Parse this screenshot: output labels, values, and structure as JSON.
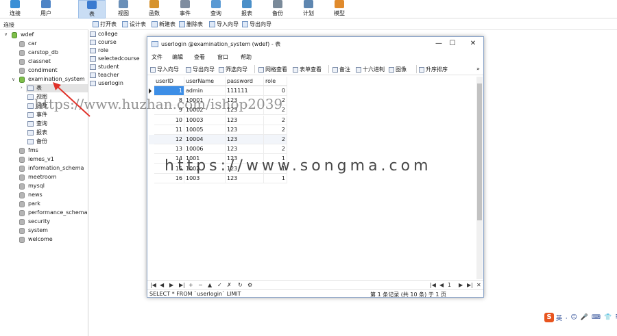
{
  "toolbar": {
    "buttons": [
      {
        "label": "连接",
        "icon": "connection-icon",
        "color": "#3a8fd6"
      },
      {
        "label": "用户",
        "icon": "user-icon",
        "color": "#4e84c6"
      },
      {
        "label": "表",
        "icon": "table-icon",
        "color": "#3b7bd0",
        "active": true
      },
      {
        "label": "视图",
        "icon": "view-icon",
        "color": "#6a8fb8"
      },
      {
        "label": "函数",
        "icon": "function-icon",
        "color": "#d6932e"
      },
      {
        "label": "事件",
        "icon": "event-icon",
        "color": "#7f8da0"
      },
      {
        "label": "查询",
        "icon": "query-icon",
        "color": "#5a9ad4"
      },
      {
        "label": "报表",
        "icon": "report-icon",
        "color": "#4a8fc8"
      },
      {
        "label": "备份",
        "icon": "backup-icon",
        "color": "#7a8a9a"
      },
      {
        "label": "计划",
        "icon": "schedule-icon",
        "color": "#5e86b0"
      },
      {
        "label": "模型",
        "icon": "model-icon",
        "color": "#e08a2c"
      }
    ]
  },
  "connection_label": "连接",
  "object_toolbar": [
    "打开表",
    "设计表",
    "新建表",
    "删除表",
    "导入向导",
    "导出向导"
  ],
  "tree": {
    "root": "wdef",
    "databases_before": [
      "car",
      "carstop_db",
      "classnet",
      "condiment"
    ],
    "open_db": "examination_system",
    "open_db_children": [
      "表",
      "视图",
      "函数",
      "事件",
      "查询",
      "报表",
      "备份"
    ],
    "databases_after": [
      "fms",
      "iemes_v1",
      "information_schema",
      "meetroom",
      "mysql",
      "news",
      "park",
      "performance_schema",
      "security",
      "system",
      "welcome"
    ]
  },
  "tables": [
    "college",
    "course",
    "role",
    "selectedcourse",
    "student",
    "teacher",
    "userlogin"
  ],
  "window": {
    "title": "userlogin @examination_system (wdef) - 表",
    "controls": [
      "—",
      "☐",
      "✕"
    ],
    "menu": [
      "文件",
      "编辑",
      "查看",
      "窗口",
      "帮助"
    ],
    "toolbar": [
      "导入向导",
      "导出向导",
      "筛选向导",
      "网格查看",
      "表单查看",
      "备注",
      "十六进制",
      "图像",
      "升序排序"
    ],
    "grid": {
      "columns": [
        "userID",
        "userName",
        "password",
        "role"
      ],
      "rows": [
        [
          "1",
          "admin",
          "111111",
          "0"
        ],
        [
          "8",
          "10001",
          "123",
          "2"
        ],
        [
          "9",
          "10002",
          "123",
          "2"
        ],
        [
          "10",
          "10003",
          "123",
          "2"
        ],
        [
          "11",
          "10005",
          "123",
          "2"
        ],
        [
          "12",
          "10004",
          "123",
          "2"
        ],
        [
          "13",
          "10006",
          "123",
          "2"
        ],
        [
          "14",
          "1001",
          "123",
          "1"
        ],
        [
          "15",
          "1002",
          "123",
          "1"
        ],
        [
          "16",
          "1003",
          "123",
          "1"
        ]
      ]
    },
    "nav_buttons": [
      "|◀",
      "◀",
      "▶",
      "▶|",
      "+",
      "−",
      "▲",
      "✓",
      "✗",
      "↻",
      "⚙"
    ],
    "status_sql": "SELECT * FROM `userlogin` LIMIT",
    "status_right": "第 1 条记录 (共 10 条) 于 1 页",
    "page_num": "1"
  },
  "watermarks": {
    "top": "https://www.huzhan.com/ishop2039",
    "center": "https://www.songma.com"
  },
  "ime": {
    "logo": "S",
    "items": [
      "英",
      "⸱",
      "☺",
      "🎤",
      "⌨",
      "👕",
      "⠿"
    ]
  }
}
